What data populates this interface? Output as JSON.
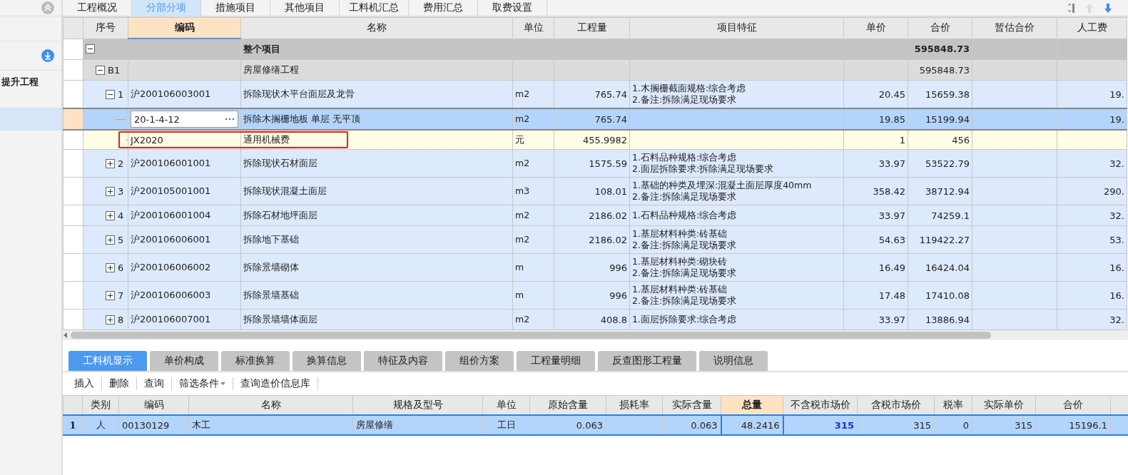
{
  "sidebar": {
    "items": [
      {
        "label": "提升工程",
        "selected": false
      },
      {
        "selected": true
      }
    ]
  },
  "top_tabs": [
    {
      "label": "工程概况",
      "selected": false
    },
    {
      "label": "分部分项",
      "selected": true
    },
    {
      "label": "措施项目",
      "selected": false
    },
    {
      "label": "其他项目",
      "selected": false
    },
    {
      "label": "工料机汇总",
      "selected": false
    },
    {
      "label": "费用汇总",
      "selected": false
    },
    {
      "label": "取费设置",
      "selected": false
    }
  ],
  "grid": {
    "columns": [
      {
        "label": "序号",
        "active": false
      },
      {
        "label": "编码",
        "active": true
      },
      {
        "label": "名称",
        "active": false
      },
      {
        "label": "单位",
        "active": false
      },
      {
        "label": "工程量",
        "active": false
      },
      {
        "label": "项目特征",
        "active": false
      },
      {
        "label": "单价",
        "active": false
      },
      {
        "label": "合价",
        "active": false
      },
      {
        "label": "暂估合价",
        "active": false
      },
      {
        "label": "人工费",
        "active": false
      }
    ],
    "rows": [
      {
        "kind": "root",
        "name": "整个项目",
        "total": "595848.73",
        "expanded": true,
        "selected": false,
        "children": [
          {
            "kind": "section",
            "seq": "B1",
            "name": "房屋修缮工程",
            "total": "595848.73",
            "expanded": true,
            "selected": false,
            "children": [
              {
                "kind": "item",
                "seq": "1",
                "code": "沪200106003001",
                "name": "拆除现状木平台面层及龙骨",
                "unit": "m2",
                "quantity": "765.74",
                "feature": [
                  "1.木搁栅截面规格:综合考虑",
                  "2.备注:拆除满足现场要求"
                ],
                "price": "20.45",
                "total": "15659.38",
                "labor": "19.",
                "expanded": true,
                "selected": false,
                "children": [
                  {
                    "kind": "quota",
                    "code": "20-1-4-12",
                    "name": "拆除木搁栅地板 单层 无平顶",
                    "unit": "m2",
                    "quantity": "765.74",
                    "price": "19.85",
                    "total": "15199.94",
                    "labor": "19.",
                    "selected": true,
                    "children": [
                      {
                        "kind": "material",
                        "code": "JX2020",
                        "name": "通用机械费",
                        "unit": "元",
                        "quantity": "455.9982",
                        "price": "1",
                        "total": "456",
                        "highlighted": true,
                        "selected": false
                      }
                    ]
                  }
                ]
              },
              {
                "kind": "item",
                "seq": "2",
                "code": "沪200106001001",
                "name": "拆除现状石材面层",
                "unit": "m2",
                "quantity": "1575.59",
                "feature": [
                  "1.石料品种规格:综合考虑",
                  "2.面层拆除要求:拆除满足现场要求"
                ],
                "price": "33.97",
                "total": "53522.79",
                "labor": "32.",
                "expanded": false,
                "selected": false
              },
              {
                "kind": "item",
                "seq": "3",
                "code": "沪200105001001",
                "name": "拆除现状混凝土面层",
                "unit": "m3",
                "quantity": "108.01",
                "feature": [
                  "1.基础的种类及埋深:混凝土面层厚度40mm",
                  "2.备注:拆除满足现场要求"
                ],
                "price": "358.42",
                "total": "38712.94",
                "labor": "290.",
                "expanded": false,
                "selected": false
              },
              {
                "kind": "item",
                "seq": "4",
                "code": "沪200106001004",
                "name": "拆除石材地坪面层",
                "unit": "m2",
                "quantity": "2186.02",
                "feature": [
                  "1.石料品种规格:综合考虑"
                ],
                "price": "33.97",
                "total": "74259.1",
                "labor": "32.",
                "expanded": false,
                "selected": false
              },
              {
                "kind": "item",
                "seq": "5",
                "code": "沪200106006001",
                "name": "拆除地下基础",
                "unit": "m2",
                "quantity": "2186.02",
                "feature": [
                  "1.基层材料种类:砖基础",
                  "2.备注:拆除满足现场要求"
                ],
                "price": "54.63",
                "total": "119422.27",
                "labor": "53.",
                "expanded": false,
                "selected": false
              },
              {
                "kind": "item",
                "seq": "6",
                "code": "沪200106006002",
                "name": "拆除景墙砌体",
                "unit": "m",
                "quantity": "996",
                "feature": [
                  "1.基层材料种类:砌块砖",
                  "2.备注:拆除满足现场要求"
                ],
                "price": "16.49",
                "total": "16424.04",
                "labor": "16.",
                "expanded": false,
                "selected": false
              },
              {
                "kind": "item",
                "seq": "7",
                "code": "沪200106006003",
                "name": "拆除景墙基础",
                "unit": "m",
                "quantity": "996",
                "feature": [
                  "1.基层材料种类:砖基础",
                  "2.备注:拆除满足现场要求"
                ],
                "price": "17.48",
                "total": "17410.08",
                "labor": "16.",
                "expanded": false,
                "selected": false
              },
              {
                "kind": "item",
                "seq": "8",
                "code": "沪200106007001",
                "name": "拆除景墙墙体面层",
                "unit": "m2",
                "quantity": "408.8",
                "feature": [
                  "1.面层拆除要求:综合考虑"
                ],
                "price": "33.97",
                "total": "13886.94",
                "labor": "32.",
                "expanded": false,
                "selected": false
              }
            ]
          }
        ]
      }
    ]
  },
  "bottom_tabs": [
    {
      "label": "工料机显示",
      "selected": true
    },
    {
      "label": "单价构成",
      "selected": false
    },
    {
      "label": "标准换算",
      "selected": false
    },
    {
      "label": "换算信息",
      "selected": false
    },
    {
      "label": "特征及内容",
      "selected": false
    },
    {
      "label": "组价方案",
      "selected": false
    },
    {
      "label": "工程量明细",
      "selected": false
    },
    {
      "label": "反查图形工程量",
      "selected": false
    },
    {
      "label": "说明信息",
      "selected": false
    }
  ],
  "toolbar": [
    {
      "label": "插入",
      "kind": "button"
    },
    {
      "label": "删除",
      "kind": "button"
    },
    {
      "label": "查询",
      "kind": "button"
    },
    {
      "label": "筛选条件",
      "kind": "dropdown"
    },
    {
      "label": "查询造价信息库",
      "kind": "button"
    }
  ],
  "resource_grid": {
    "columns": [
      {
        "label": "类别",
        "active": false
      },
      {
        "label": "编码",
        "active": false
      },
      {
        "label": "名称",
        "active": false
      },
      {
        "label": "规格及型号",
        "active": false
      },
      {
        "label": "单位",
        "active": false
      },
      {
        "label": "原始含量",
        "active": false
      },
      {
        "label": "损耗率",
        "active": false
      },
      {
        "label": "实际含量",
        "active": false
      },
      {
        "label": "总量",
        "active": true
      },
      {
        "label": "不含税市场价",
        "active": false
      },
      {
        "label": "含税市场价",
        "active": false
      },
      {
        "label": "税率",
        "active": false
      },
      {
        "label": "实际单价",
        "active": false
      },
      {
        "label": "合价",
        "active": false
      }
    ],
    "rows": [
      {
        "number": "1",
        "selected": true,
        "category": "人",
        "code": "00130129",
        "name": "木工",
        "spec": "房屋修缮",
        "unit": "工日",
        "original_amount": "0.063",
        "actual_amount": "0.063",
        "total_amount": "48.2416",
        "market_price_excl_tax": "315",
        "market_price_incl_tax": "315",
        "tax_rate": "0",
        "actual_price": "315",
        "total": "15196.1"
      }
    ]
  }
}
